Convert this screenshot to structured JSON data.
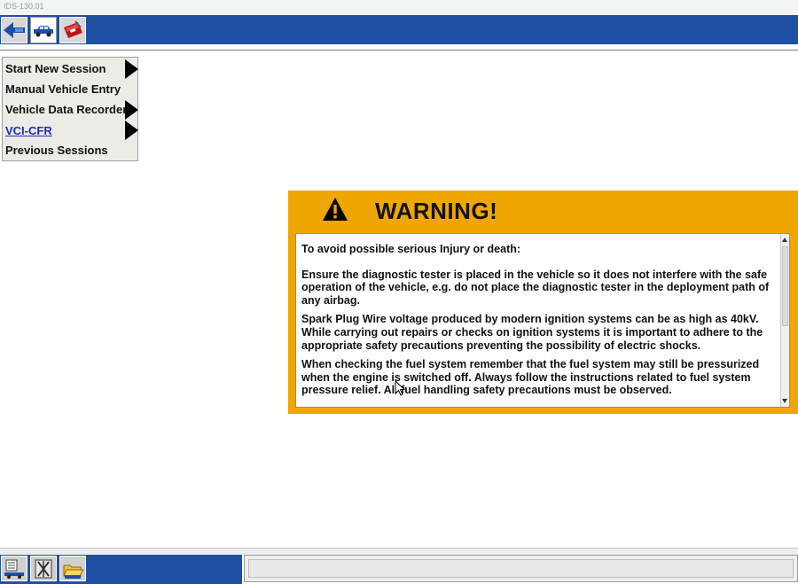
{
  "window": {
    "title": "IDS-130.01"
  },
  "toolbar": {
    "buttons": [
      {
        "icon": "back-arrow-icon"
      },
      {
        "icon": "vehicle-icon"
      },
      {
        "icon": "toolbox-icon"
      }
    ]
  },
  "menu": {
    "items": [
      {
        "label": "Start New Session",
        "has_submenu": true
      },
      {
        "label": "Manual Vehicle Entry",
        "has_submenu": false
      },
      {
        "label": "Vehicle Data Recorder",
        "has_submenu": true
      },
      {
        "label": "VCI-CFR",
        "has_submenu": true,
        "link": true
      },
      {
        "label": "Previous Sessions",
        "has_submenu": false
      }
    ]
  },
  "warning": {
    "title": "WARNING!",
    "paragraphs": [
      "To avoid possible serious Injury or death:",
      "Ensure the diagnostic tester is placed in the vehicle so it does not interfere with the safe operation of the vehicle, e.g. do not place the diagnostic tester in the deployment path of any airbag.",
      "Spark Plug Wire voltage produced by modern ignition systems can be as high as 40kV. While carrying out repairs or checks on ignition systems it is important to adhere to the appropriate safety precautions preventing the possibility of electric shocks.",
      "When checking the fuel system remember that the fuel system may still be pressurized when the engine is switched off. Always follow the instructions related to fuel system pressure relief. All fuel handling safety precautions must be observed."
    ],
    "accent_color": "#f0a600"
  },
  "bottom_toolbar": {
    "buttons": [
      {
        "icon": "vehicle-list-icon"
      },
      {
        "icon": "diagnostic-tools-icon"
      },
      {
        "icon": "open-folder-icon"
      }
    ]
  },
  "colors": {
    "toolbar_blue": "#1e4fa3"
  }
}
